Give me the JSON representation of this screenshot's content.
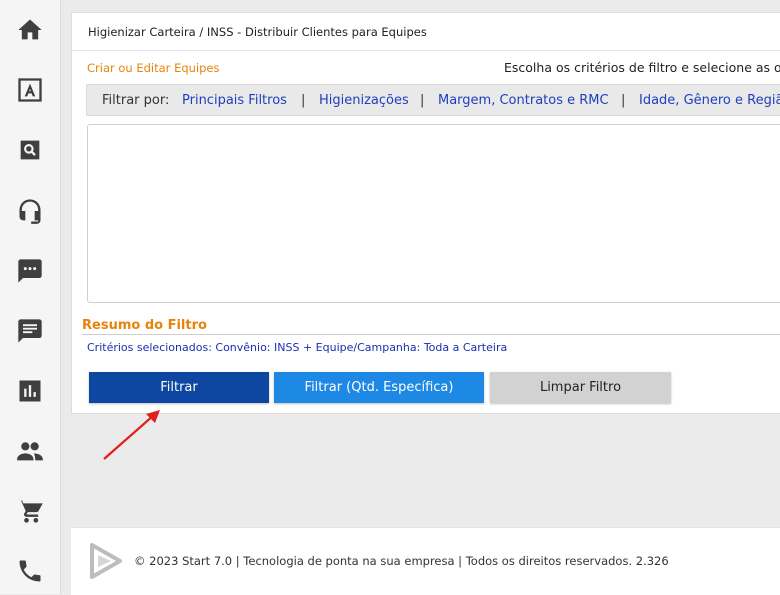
{
  "sidebar": {
    "icons": [
      "home-icon",
      "font-icon",
      "search-icon",
      "headset-icon",
      "chat-icon",
      "message-icon",
      "bar-chart-icon",
      "people-icon",
      "cart-icon",
      "phone-icon"
    ]
  },
  "header": {
    "breadcrumb": "Higienizar Carteira / INSS - Distribuir Clientes para Equipes"
  },
  "main": {
    "create_link": "Criar ou Editar Equipes",
    "choose_text": "Escolha os critérios de filtro e selecione as opçõ",
    "filter_bar": {
      "label": "Filtrar por:",
      "links": [
        "Principais Filtros",
        "Higienizações",
        "Margem, Contratos e RMC",
        "Idade, Gênero e Regiã"
      ],
      "separator": "|"
    },
    "summary": {
      "title": "Resumo do Filtro",
      "text": "Critérios selecionados: Convênio: INSS + Equipe/Campanha: Toda a Carteira"
    },
    "buttons": {
      "filter": "Filtrar",
      "filter_qty": "Filtrar (Qtd. Específica)",
      "clear": "Limpar Filtro"
    }
  },
  "footer": {
    "text": "© 2023 Start 7.0 | Tecnologia de ponta na sua empresa | Todos os direitos reservados. 2.326"
  },
  "colors": {
    "accent_orange": "#e8830c",
    "link_blue": "#1d3fbf",
    "button_primary": "#0d47a1",
    "button_secondary": "#1e88e5",
    "button_clear": "#d2d2d2",
    "annotation_arrow": "#e0201c"
  }
}
